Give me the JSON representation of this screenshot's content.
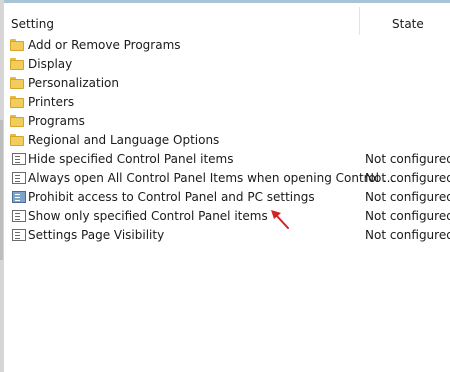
{
  "header": {
    "setting_label": "Setting",
    "state_label": "State"
  },
  "folders": [
    {
      "label": "Add or Remove Programs",
      "icon": "folder-icon"
    },
    {
      "label": "Display",
      "icon": "folder-icon"
    },
    {
      "label": "Personalization",
      "icon": "folder-icon"
    },
    {
      "label": "Printers",
      "icon": "folder-icon"
    },
    {
      "label": "Programs",
      "icon": "folder-icon"
    },
    {
      "label": "Regional and Language Options",
      "icon": "folder-icon"
    }
  ],
  "settings": [
    {
      "label": "Hide specified Control Panel items",
      "state": "Not configured",
      "icon": "policy-setting-icon"
    },
    {
      "label": "Always open All Control Panel Items when opening Control ...",
      "state": "Not configured",
      "icon": "policy-setting-icon"
    },
    {
      "label": "Prohibit access to Control Panel and PC settings",
      "state": "Not configured",
      "icon": "policy-setting-selected-icon"
    },
    {
      "label": "Show only specified Control Panel items",
      "state": "Not configured",
      "icon": "policy-setting-icon"
    },
    {
      "label": "Settings Page Visibility",
      "state": "Not configured",
      "icon": "policy-setting-icon"
    }
  ],
  "colors": {
    "folder": "#f3cd5b",
    "annotation_arrow": "#d42020",
    "header_strip": "#a9c3d6"
  }
}
